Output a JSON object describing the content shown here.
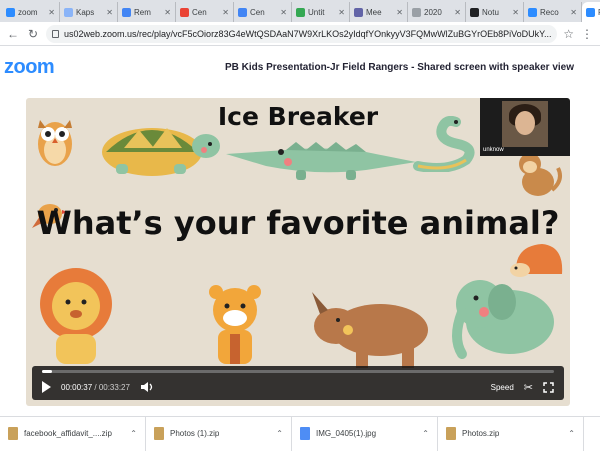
{
  "browser": {
    "tabs": [
      {
        "label": "zoom",
        "color": "#2d8cff"
      },
      {
        "label": "Kaps",
        "color": "#8ab4f8"
      },
      {
        "label": "Rem",
        "color": "#4285f4"
      },
      {
        "label": "Cen",
        "color": "#ea4335"
      },
      {
        "label": "Cen",
        "color": "#4285f4"
      },
      {
        "label": "Untit",
        "color": "#34a853"
      },
      {
        "label": "Mee",
        "color": "#6264a7"
      },
      {
        "label": "2020",
        "color": "#9aa0a6"
      },
      {
        "label": "Notu",
        "color": "#202124"
      },
      {
        "label": "Reco",
        "color": "#2d8cff"
      },
      {
        "label": "PB",
        "color": "#2d8cff"
      }
    ],
    "url": "us02web.zoom.us/rec/play/vcF5cOiorz83G4eWtQSDAaN7W9XrLKOs2yIdqfYOnkyyV3FQMwWlZuBGYrOEb8PiVoDUkY..."
  },
  "zoom": {
    "logo": "zoom",
    "meeting_title": "PB Kids Presentation-Jr Field Rangers - Shared screen with speaker view"
  },
  "slide": {
    "title": "Ice Breaker",
    "question": "What’s your favorite animal?"
  },
  "speaker": {
    "name": "unknow"
  },
  "player": {
    "current_time": "00:00:37",
    "separator": " / ",
    "duration": "00:33:27",
    "progress_fraction": 0.02,
    "speed_label": "Speed"
  },
  "downloads": [
    {
      "name": "facebook_affidavit_....zip",
      "kind": "zip"
    },
    {
      "name": "Photos (1).zip",
      "kind": "zip"
    },
    {
      "name": "IMG_0405(1).jpg",
      "kind": "img"
    },
    {
      "name": "Photos.zip",
      "kind": "zip"
    }
  ],
  "icons": {
    "back": "back-arrow-icon",
    "refresh": "refresh-icon",
    "lock": "lock-icon",
    "bookmark": "star-icon",
    "play": "play-icon",
    "volume": "volume-icon",
    "scissors": "scissors-icon",
    "fullscreen": "fullscreen-icon"
  }
}
